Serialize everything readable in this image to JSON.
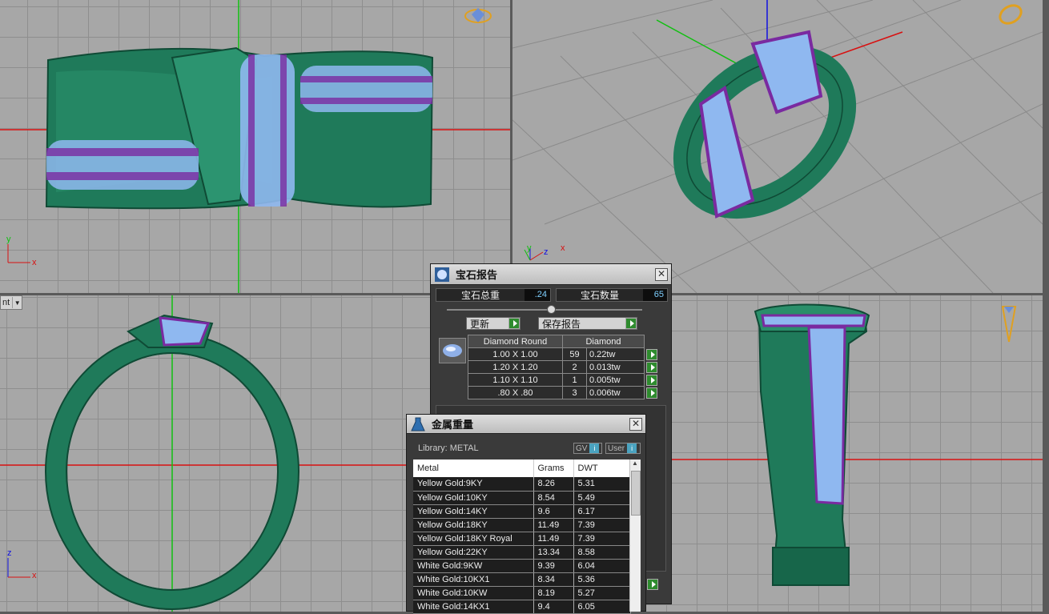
{
  "viewports": {
    "bottom_left_menu_text": "nt",
    "axes": {
      "top_left": [
        "y",
        "x"
      ],
      "top_right": [
        "y",
        "z",
        "x"
      ],
      "bottom_left": [
        "z",
        "x"
      ]
    }
  },
  "gem_report": {
    "title": "宝石报告",
    "total_weight_label": "宝石总重",
    "total_weight_value": ".24",
    "count_label": "宝石数量",
    "count_value": "65",
    "update_label": "更新",
    "save_label": "保存报告",
    "headers": [
      "Diamond Round",
      "Diamond"
    ],
    "rows": [
      {
        "size": "1.00 X 1.00",
        "qty": "59",
        "tw": "0.22tw"
      },
      {
        "size": "1.20 X 1.20",
        "qty": "2",
        "tw": "0.013tw"
      },
      {
        "size": "1.10 X 1.10",
        "qty": "1",
        "tw": "0.005tw"
      },
      {
        "size": ".80 X .80",
        "qty": "3",
        "tw": "0.006tw"
      }
    ]
  },
  "metal_weight": {
    "title": "金属重量",
    "library_label": "Library: METAL",
    "gv_label": "GV",
    "user_label": "User",
    "headers": [
      "Metal",
      "Grams",
      "DWT"
    ],
    "rows": [
      {
        "metal": "Yellow Gold:9KY",
        "grams": "8.26",
        "dwt": "5.31"
      },
      {
        "metal": "Yellow Gold:10KY",
        "grams": "8.54",
        "dwt": "5.49"
      },
      {
        "metal": "Yellow Gold:14KY",
        "grams": "9.6",
        "dwt": "6.17"
      },
      {
        "metal": "Yellow Gold:18KY",
        "grams": "11.49",
        "dwt": "7.39"
      },
      {
        "metal": "Yellow Gold:18KY Royal",
        "grams": "11.49",
        "dwt": "7.39"
      },
      {
        "metal": "Yellow Gold:22KY",
        "grams": "13.34",
        "dwt": "8.58"
      },
      {
        "metal": "White Gold:9KW",
        "grams": "9.39",
        "dwt": "6.04"
      },
      {
        "metal": "White Gold:10KX1",
        "grams": "8.34",
        "dwt": "5.36"
      },
      {
        "metal": "White Gold:10KW",
        "grams": "8.19",
        "dwt": "5.27"
      },
      {
        "metal": "White Gold:14KX1",
        "grams": "9.4",
        "dwt": "6.05"
      }
    ]
  },
  "colors": {
    "ring_green": "#1f7a5a",
    "gem_blue": "#8fb8f0",
    "gem_purple": "#7a2aa0",
    "axis_red": "#d81010",
    "axis_green": "#10c010",
    "axis_blue": "#1010e0"
  }
}
